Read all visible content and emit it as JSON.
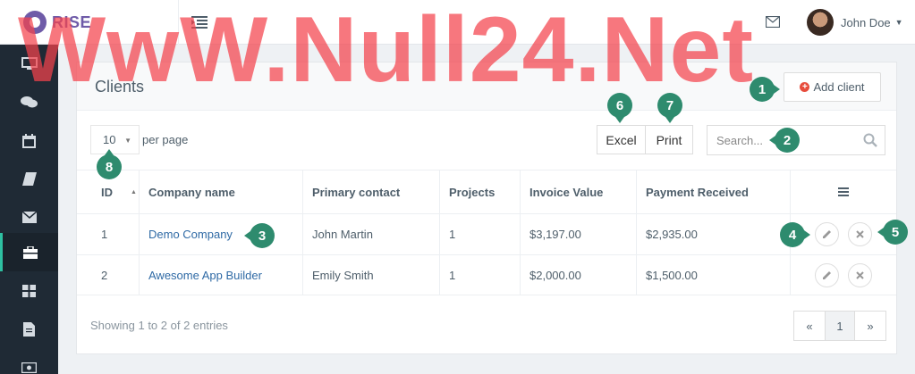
{
  "app": {
    "brand": "RISE"
  },
  "header": {
    "user_name": "John Doe"
  },
  "sidebar": {
    "items": [
      {
        "icon": "monitor-icon"
      },
      {
        "icon": "chat-icon"
      },
      {
        "icon": "calendar-icon"
      },
      {
        "icon": "book-icon"
      },
      {
        "icon": "mail-icon"
      },
      {
        "icon": "briefcase-icon",
        "active": true
      },
      {
        "icon": "grid-icon"
      },
      {
        "icon": "file-icon"
      },
      {
        "icon": "money-icon"
      }
    ]
  },
  "page": {
    "title": "Clients",
    "add_button": "Add client"
  },
  "toolbar": {
    "per_page_value": "10",
    "per_page_label": "per page",
    "excel_label": "Excel",
    "print_label": "Print",
    "search_placeholder": "Search..."
  },
  "table": {
    "headers": [
      "ID",
      "Company name",
      "Primary contact",
      "Projects",
      "Invoice Value",
      "Payment Received"
    ],
    "rows": [
      {
        "id": "1",
        "company": "Demo Company",
        "contact": "John Martin",
        "projects": "1",
        "invoice": "$3,197.00",
        "payment": "$2,935.00"
      },
      {
        "id": "2",
        "company": "Awesome App Builder",
        "contact": "Emily Smith",
        "projects": "1",
        "invoice": "$2,000.00",
        "payment": "$1,500.00"
      }
    ]
  },
  "footer": {
    "info": "Showing 1 to 2 of 2 entries",
    "prev": "«",
    "current_page": "1",
    "next": "»"
  },
  "callouts": [
    "1",
    "2",
    "3",
    "4",
    "5",
    "6",
    "7",
    "8"
  ],
  "watermark": "WwW.Null24.Net",
  "colors": {
    "accent": "#2ec0a2",
    "brand": "#6f5ba8",
    "link": "#2f6aa5",
    "callout": "#2e8b6e",
    "sidebar": "#1f2a35"
  }
}
